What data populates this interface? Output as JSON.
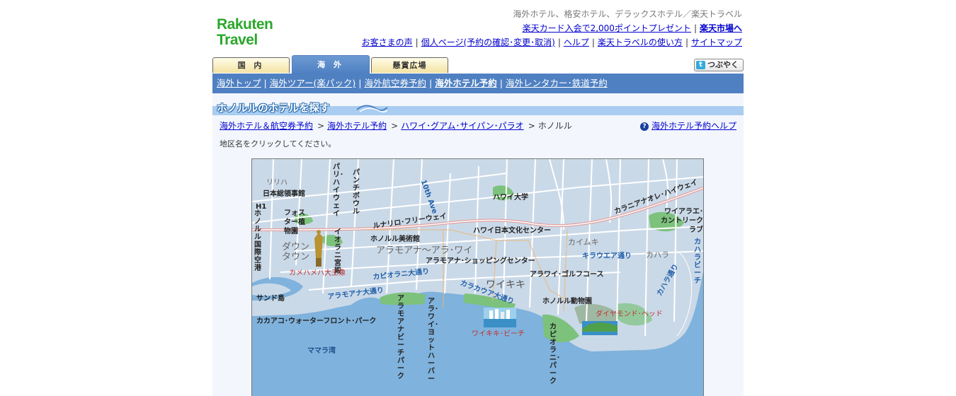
{
  "header": {
    "logo_line1": "Rakuten",
    "logo_line2": "Travel",
    "tagline": "海外ホテル、格安ホテル、デラックスホテル／楽天トラベル",
    "row1": [
      "楽天カード入会で2,000ポイントプレゼント",
      "楽天市場へ"
    ],
    "row2": [
      "お客さまの声",
      "個人ページ(予約の確認･変更･取消)",
      "ヘルプ",
      "楽天トラベルの使い方",
      "サイトマップ"
    ]
  },
  "tabs": [
    "国 内",
    "海 外",
    "懸賞広場"
  ],
  "active_tab": "海 外",
  "tweet_label": "つぶやく",
  "subnav": [
    "海外トップ",
    "海外ツアー(楽パック)",
    "海外航空券予約",
    "海外ホテル予約",
    "海外レンタカー･鉄道予約"
  ],
  "subnav_current": "海外ホテル予約",
  "page_title": "ホノルルのホテルを探す",
  "breadcrumb": [
    "海外ホテル＆航空券予約",
    "海外ホテル予約",
    "ハワイ･グアム･サイパン･パラオ",
    "ホノルル"
  ],
  "help_link": "海外ホテル予約ヘルプ",
  "instruction": "地区名をクリックしてください。",
  "map": {
    "districts": [
      "ダウン タウン",
      "アラモアナ～アラ･ワイ",
      "ワイキキ",
      "カイムキ",
      "カハラ"
    ],
    "landmarks": [
      "日本総領事館",
      "リリハ",
      "フォスター植物園",
      "ホノルル美術館",
      "イオラニ宮殿",
      "ハワイ大学",
      "ハワイ日本文化センター",
      "アラモアナ･ショッピングセンター",
      "アラワイ･ゴルフコース",
      "ホノルル動物園",
      "ワイアラエ･カントリークラブ",
      "カメハメハ大王像",
      "ワイキキ･ビーチ",
      "ダイヤモンド･ヘッド",
      "サンド島",
      "カカアコ･ウォーターフロント･パーク",
      "ママラ湾",
      "ホノルル国際空港",
      "アラモアナビーチパーク",
      "アラ･ワイ･ヨットハーバー",
      "カピオラニ･パーク"
    ],
    "roads": [
      "H1",
      "ルナリロ･フリーウェイ",
      "カラニアナオレ･ハイウェイ",
      "カピオラニ大通り",
      "アラモアナ大通り",
      "カラカウア大通り",
      "キラウエア通り",
      "カハラ通り",
      "カハラビーチ",
      "パンチボウル",
      "パリ･ハイウェイ",
      "10th Ave"
    ],
    "colors": {
      "sea": "#7fb2dc",
      "land": "#cad9e8",
      "park": "#7cc27c",
      "roads": "#ffffff",
      "accent": "#4f80c2"
    }
  }
}
